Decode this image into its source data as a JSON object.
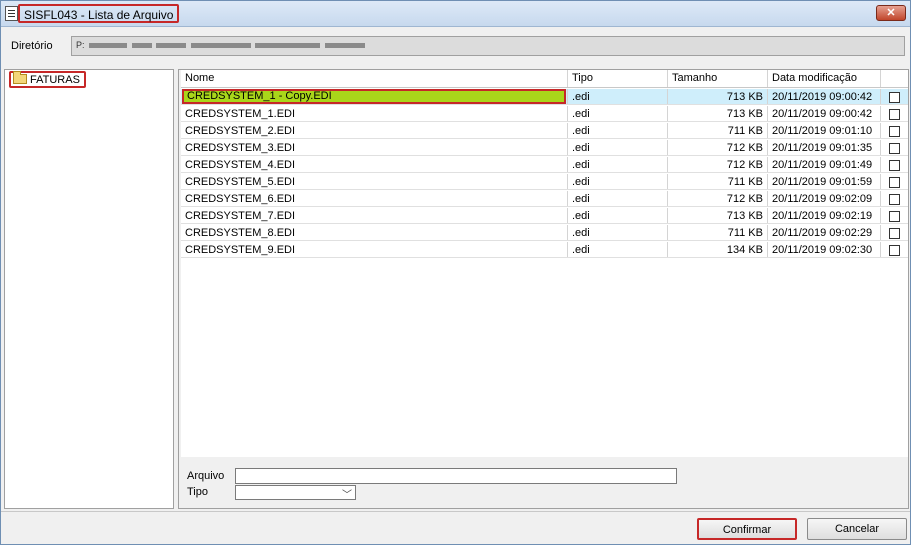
{
  "window": {
    "title": "SISFL043 - Lista de Arquivo",
    "close_label": "✕"
  },
  "directory": {
    "label": "Diretório",
    "value": "P:"
  },
  "tree": {
    "items": [
      {
        "label": "FATURAS"
      }
    ]
  },
  "grid": {
    "headers": {
      "name": "Nome",
      "type": "Tipo",
      "size": "Tamanho",
      "date": "Data modificação"
    },
    "rows": [
      {
        "name": "CREDSYSTEM_1 - Copy.EDI",
        "type": ".edi",
        "size": "713 KB",
        "date": "20/11/2019 09:00:42",
        "checked": false
      },
      {
        "name": "CREDSYSTEM_1.EDI",
        "type": ".edi",
        "size": "713 KB",
        "date": "20/11/2019 09:00:42",
        "checked": false
      },
      {
        "name": "CREDSYSTEM_2.EDI",
        "type": ".edi",
        "size": "711 KB",
        "date": "20/11/2019 09:01:10",
        "checked": false
      },
      {
        "name": "CREDSYSTEM_3.EDI",
        "type": ".edi",
        "size": "712 KB",
        "date": "20/11/2019 09:01:35",
        "checked": false
      },
      {
        "name": "CREDSYSTEM_4.EDI",
        "type": ".edi",
        "size": "712 KB",
        "date": "20/11/2019 09:01:49",
        "checked": false
      },
      {
        "name": "CREDSYSTEM_5.EDI",
        "type": ".edi",
        "size": "711 KB",
        "date": "20/11/2019 09:01:59",
        "checked": false
      },
      {
        "name": "CREDSYSTEM_6.EDI",
        "type": ".edi",
        "size": "712 KB",
        "date": "20/11/2019 09:02:09",
        "checked": false
      },
      {
        "name": "CREDSYSTEM_7.EDI",
        "type": ".edi",
        "size": "713 KB",
        "date": "20/11/2019 09:02:19",
        "checked": false
      },
      {
        "name": "CREDSYSTEM_8.EDI",
        "type": ".edi",
        "size": "711 KB",
        "date": "20/11/2019 09:02:29",
        "checked": false
      },
      {
        "name": "CREDSYSTEM_9.EDI",
        "type": ".edi",
        "size": "134 KB",
        "date": "20/11/2019 09:02:30",
        "checked": false
      }
    ]
  },
  "form": {
    "file_label": "Arquivo",
    "file_value": "",
    "type_label": "Tipo",
    "type_value": ""
  },
  "buttons": {
    "confirm": "Confirmar",
    "cancel": "Cancelar"
  },
  "colors": {
    "highlight": "#c62828",
    "selected_row": "#cfeefb",
    "selected_name": "#a9d61a"
  }
}
